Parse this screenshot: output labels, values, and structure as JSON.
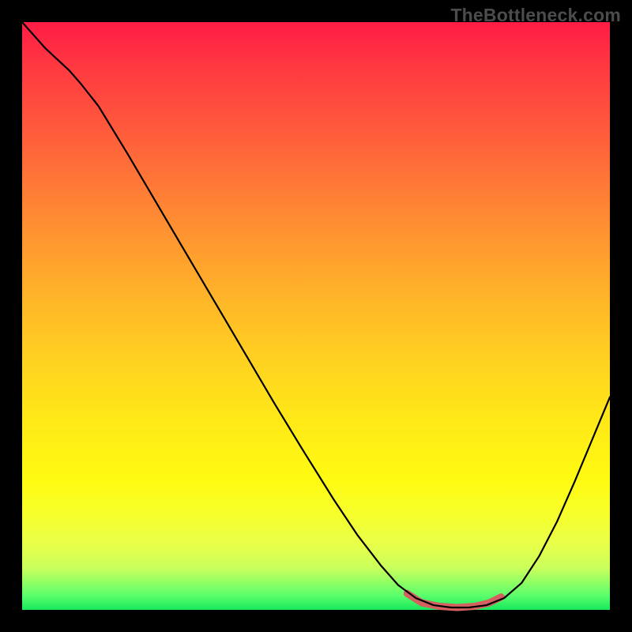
{
  "watermark": "TheBottleneck.com",
  "chart_data": {
    "type": "line",
    "title": "",
    "xlabel": "",
    "ylabel": "",
    "xlim": [
      0,
      1
    ],
    "ylim": [
      0,
      1
    ],
    "grid": false,
    "legend": false,
    "series": [
      {
        "name": "bottleneck-curve",
        "color": "#000000",
        "points": [
          {
            "x": 0.0,
            "y": 1.0
          },
          {
            "x": 0.04,
            "y": 0.955
          },
          {
            "x": 0.08,
            "y": 0.918
          },
          {
            "x": 0.1,
            "y": 0.895
          },
          {
            "x": 0.13,
            "y": 0.857
          },
          {
            "x": 0.18,
            "y": 0.775
          },
          {
            "x": 0.23,
            "y": 0.69
          },
          {
            "x": 0.28,
            "y": 0.605
          },
          {
            "x": 0.33,
            "y": 0.52
          },
          {
            "x": 0.38,
            "y": 0.435
          },
          {
            "x": 0.43,
            "y": 0.35
          },
          {
            "x": 0.48,
            "y": 0.268
          },
          {
            "x": 0.53,
            "y": 0.188
          },
          {
            "x": 0.57,
            "y": 0.128
          },
          {
            "x": 0.61,
            "y": 0.076
          },
          {
            "x": 0.64,
            "y": 0.042
          },
          {
            "x": 0.67,
            "y": 0.02
          },
          {
            "x": 0.7,
            "y": 0.008
          },
          {
            "x": 0.73,
            "y": 0.004
          },
          {
            "x": 0.76,
            "y": 0.004
          },
          {
            "x": 0.79,
            "y": 0.008
          },
          {
            "x": 0.82,
            "y": 0.02
          },
          {
            "x": 0.85,
            "y": 0.046
          },
          {
            "x": 0.88,
            "y": 0.092
          },
          {
            "x": 0.91,
            "y": 0.15
          },
          {
            "x": 0.94,
            "y": 0.218
          },
          {
            "x": 0.97,
            "y": 0.29
          },
          {
            "x": 1.0,
            "y": 0.362
          }
        ]
      },
      {
        "name": "optimal-range-highlight",
        "color": "#d46060",
        "x_range": [
          0.655,
          0.815
        ],
        "points": [
          {
            "x": 0.655,
            "y": 0.028
          },
          {
            "x": 0.68,
            "y": 0.012
          },
          {
            "x": 0.71,
            "y": 0.006
          },
          {
            "x": 0.74,
            "y": 0.004
          },
          {
            "x": 0.77,
            "y": 0.006
          },
          {
            "x": 0.795,
            "y": 0.012
          },
          {
            "x": 0.815,
            "y": 0.022
          }
        ]
      }
    ]
  }
}
